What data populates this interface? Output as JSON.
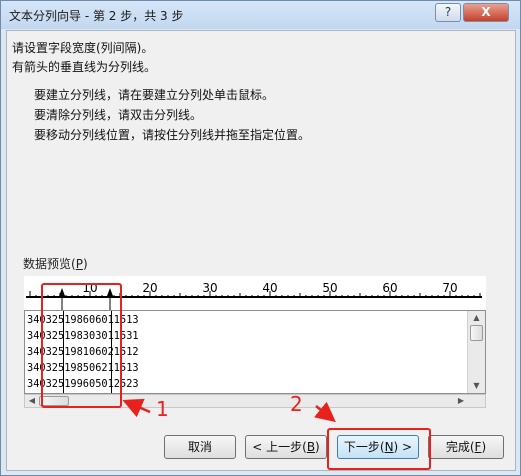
{
  "window": {
    "title": "文本分列向导 - 第 2 步，共 3 步",
    "help_label": "?",
    "close_label": "X"
  },
  "intro": {
    "line1": "请设置字段宽度(列间隔)。",
    "line2": "有箭头的垂直线为分列线。"
  },
  "instructions": [
    "要建立分列线，请在要建立分列处单击鼠标。",
    "要清除分列线，请双击分列线。",
    "要移动分列线位置，请按住分列线并拖至指定位置。"
  ],
  "preview": {
    "label_text": "数据预览(",
    "label_key": "P",
    "label_end": ")",
    "ruler_ticks": [
      "10",
      "20",
      "30",
      "40",
      "50",
      "60",
      "70"
    ],
    "rows": [
      "340325198606011513",
      "340325198303011531",
      "340325198106021512",
      "340325198506211513",
      "340325199605012523"
    ]
  },
  "buttons": {
    "cancel": "取消",
    "prev_text": "< 上一步(",
    "prev_key": "B",
    "prev_end": ")",
    "next_text": "下一步(",
    "next_key": "N",
    "next_end": ") >",
    "finish_text": "完成(",
    "finish_key": "F",
    "finish_end": ")"
  },
  "annotations": {
    "label1": "1",
    "label2": "2"
  },
  "colors": {
    "annotation_red": "#e8211d",
    "title_bar": "#c8dcf2",
    "dialog_bg": "#f0f0f0",
    "primary_button_border": "#3c7fb1"
  }
}
